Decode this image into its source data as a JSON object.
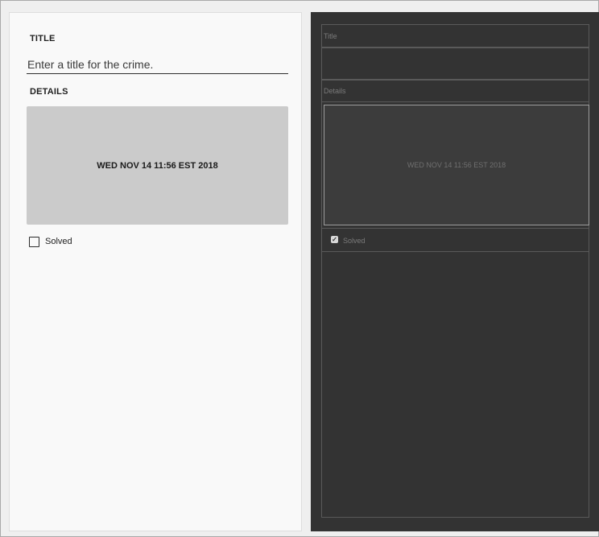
{
  "design_preview": {
    "title_label": "TITLE",
    "title_placeholder": "Enter a title for the crime.",
    "title_value": "",
    "details_label": "DETAILS",
    "date_button_label": "WED NOV 14 11:56 EST 2018",
    "solved_label": "Solved",
    "solved_checked": false
  },
  "blueprint_preview": {
    "title_label": "Title",
    "details_label": "Details",
    "date_button_label": "WED NOV 14 11:56 EST 2018",
    "solved_label": "Solved",
    "solved_checked": true,
    "check_icon": "✓"
  },
  "colors": {
    "design_background": "#f9f9f9",
    "date_button_background": "#cbcbcb",
    "blueprint_background": "#333333",
    "blueprint_outline": "#5a5a5a"
  }
}
